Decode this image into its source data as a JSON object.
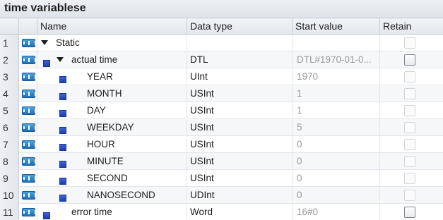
{
  "window": {
    "title": "time variablese"
  },
  "columns": {
    "name": "Name",
    "data_type": "Data type",
    "start_value": "Start value",
    "retain": "Retain"
  },
  "rows": [
    {
      "num": "1",
      "name": "Static",
      "type": "",
      "start": "",
      "level": 0,
      "caret": true,
      "square": false
    },
    {
      "num": "2",
      "name": "actual time",
      "type": "DTL",
      "start": "DTL#1970-01-0...",
      "level": 1,
      "caret": true,
      "square": true
    },
    {
      "num": "3",
      "name": "YEAR",
      "type": "UInt",
      "start": "1970",
      "level": 2,
      "caret": false,
      "square": true
    },
    {
      "num": "4",
      "name": "MONTH",
      "type": "USInt",
      "start": "1",
      "level": 2,
      "caret": false,
      "square": true
    },
    {
      "num": "5",
      "name": "DAY",
      "type": "USInt",
      "start": "1",
      "level": 2,
      "caret": false,
      "square": true
    },
    {
      "num": "6",
      "name": "WEEKDAY",
      "type": "USInt",
      "start": "5",
      "level": 2,
      "caret": false,
      "square": true
    },
    {
      "num": "7",
      "name": "HOUR",
      "type": "USInt",
      "start": "0",
      "level": 2,
      "caret": false,
      "square": true
    },
    {
      "num": "8",
      "name": "MINUTE",
      "type": "USInt",
      "start": "0",
      "level": 2,
      "caret": false,
      "square": true
    },
    {
      "num": "9",
      "name": "SECOND",
      "type": "USInt",
      "start": "0",
      "level": 2,
      "caret": false,
      "square": true
    },
    {
      "num": "10",
      "name": "NANOSECOND",
      "type": "UDInt",
      "start": "0",
      "level": 2,
      "caret": false,
      "square": true
    },
    {
      "num": "11",
      "name": "error time",
      "type": "Word",
      "start": "16#0",
      "level": 1,
      "caret": false,
      "square": true
    }
  ],
  "colors": {
    "accent": "#1d6fb8",
    "member_square": "#2a4bc4",
    "start_value_text": "#9a9a9a"
  },
  "icons": {
    "db_row_icon": "db-interface-icon",
    "member_icon": "member-square-icon",
    "expand_icon": "expand-caret-icon"
  }
}
